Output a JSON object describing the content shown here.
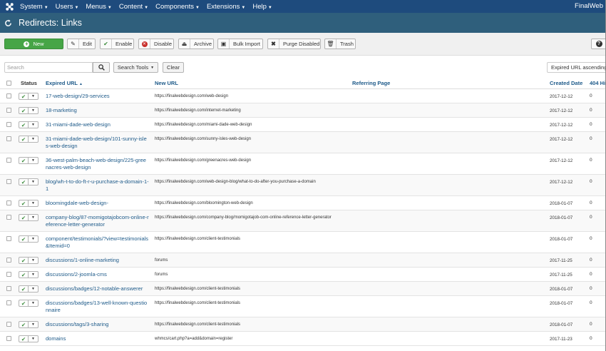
{
  "navbar": {
    "menu": [
      "System",
      "Users",
      "Menus",
      "Content",
      "Components",
      "Extensions",
      "Help"
    ],
    "site_name": "FinalWeb"
  },
  "page": {
    "title": "Redirects: Links"
  },
  "toolbar": {
    "new": "New",
    "edit": "Edit",
    "enable": "Enable",
    "disable": "Disable",
    "archive": "Archive",
    "bulk_import": "Bulk Import",
    "purge_disabled": "Purge Disabled",
    "trash": "Trash"
  },
  "filters": {
    "search_placeholder": "Search",
    "search_tools": "Search Tools",
    "clear": "Clear",
    "ordering": "Expired URL ascending"
  },
  "table": {
    "headers": {
      "status": "Status",
      "expired_url": "Expired URL",
      "new_url": "New URL",
      "referring_page": "Referring Page",
      "created_date": "Created Date",
      "hits": "404 Hi"
    },
    "rows": [
      {
        "expired": "17-web-design/29-services",
        "new": "https://finalwebdesign.com/web-design",
        "date": "2017-12-12",
        "hits": "0"
      },
      {
        "expired": "18-marketing",
        "new": "https://finalwebdesign.com/internet-marketing",
        "date": "2017-12-12",
        "hits": "0"
      },
      {
        "expired": "31-miami-dade-web-design",
        "new": "https://finalwebdesign.com/miami-dade-web-design",
        "date": "2017-12-12",
        "hits": "0"
      },
      {
        "expired": "31-miami-dade-web-design/101-sunny-isles-web-design",
        "new": "https://finalwebdesign.com/sunny-isles-web-design",
        "date": "2017-12-12",
        "hits": "0"
      },
      {
        "expired": "36-west-palm-beach-web-design/225-greenacres-web-design",
        "new": "https://finalwebdesign.com/greenacres-web-design",
        "date": "2017-12-12",
        "hits": "0"
      },
      {
        "expired": "blog/wh-t-to-do-ft-r-u-purchase-a-domain-1-1",
        "new": "https://finalwebdesign.com/web-design-blog/what-to-do-after-you-purchase-a-domain",
        "date": "2017-12-12",
        "hits": "0"
      },
      {
        "expired": "bloomingdale-web-design-",
        "new": "https://finalwebdesign.com/bloomington-web-design",
        "date": "2018-01-07",
        "hits": "0"
      },
      {
        "expired": "company-blog/87-momigotajobcom-online-reference-letter-generator",
        "new": "https://finalwebdesign.com/company-blog/momigotajob-com-online-reference-letter-generator",
        "date": "2018-01-07",
        "hits": "0"
      },
      {
        "expired": "component/testimonials/?view=testimonials&Itemid=0",
        "new": "https://finalwebdesign.com/client-testimonials",
        "date": "2018-01-07",
        "hits": "0"
      },
      {
        "expired": "discussions/1-online-marketing",
        "new": "forums",
        "date": "2017-11-25",
        "hits": "0"
      },
      {
        "expired": "discussions/2-joomla-cms",
        "new": "forums",
        "date": "2017-11-25",
        "hits": "0"
      },
      {
        "expired": "discussions/badges/12-notable-answerer",
        "new": "https://finalwebdesign.com/client-testimonials",
        "date": "2018-01-07",
        "hits": "0"
      },
      {
        "expired": "discussions/badges/13-well-known-questionnaire",
        "new": "https://finalwebdesign.com/client-testimonials",
        "date": "2018-01-07",
        "hits": "0"
      },
      {
        "expired": "discussions/tags/3-sharing",
        "new": "https://finalwebdesign.com/client-testimonials",
        "date": "2018-01-07",
        "hits": "0"
      },
      {
        "expired": "domains",
        "new": "whmcs/cart.php?a=add&domain=register",
        "date": "2017-11-23",
        "hits": "0"
      }
    ]
  }
}
